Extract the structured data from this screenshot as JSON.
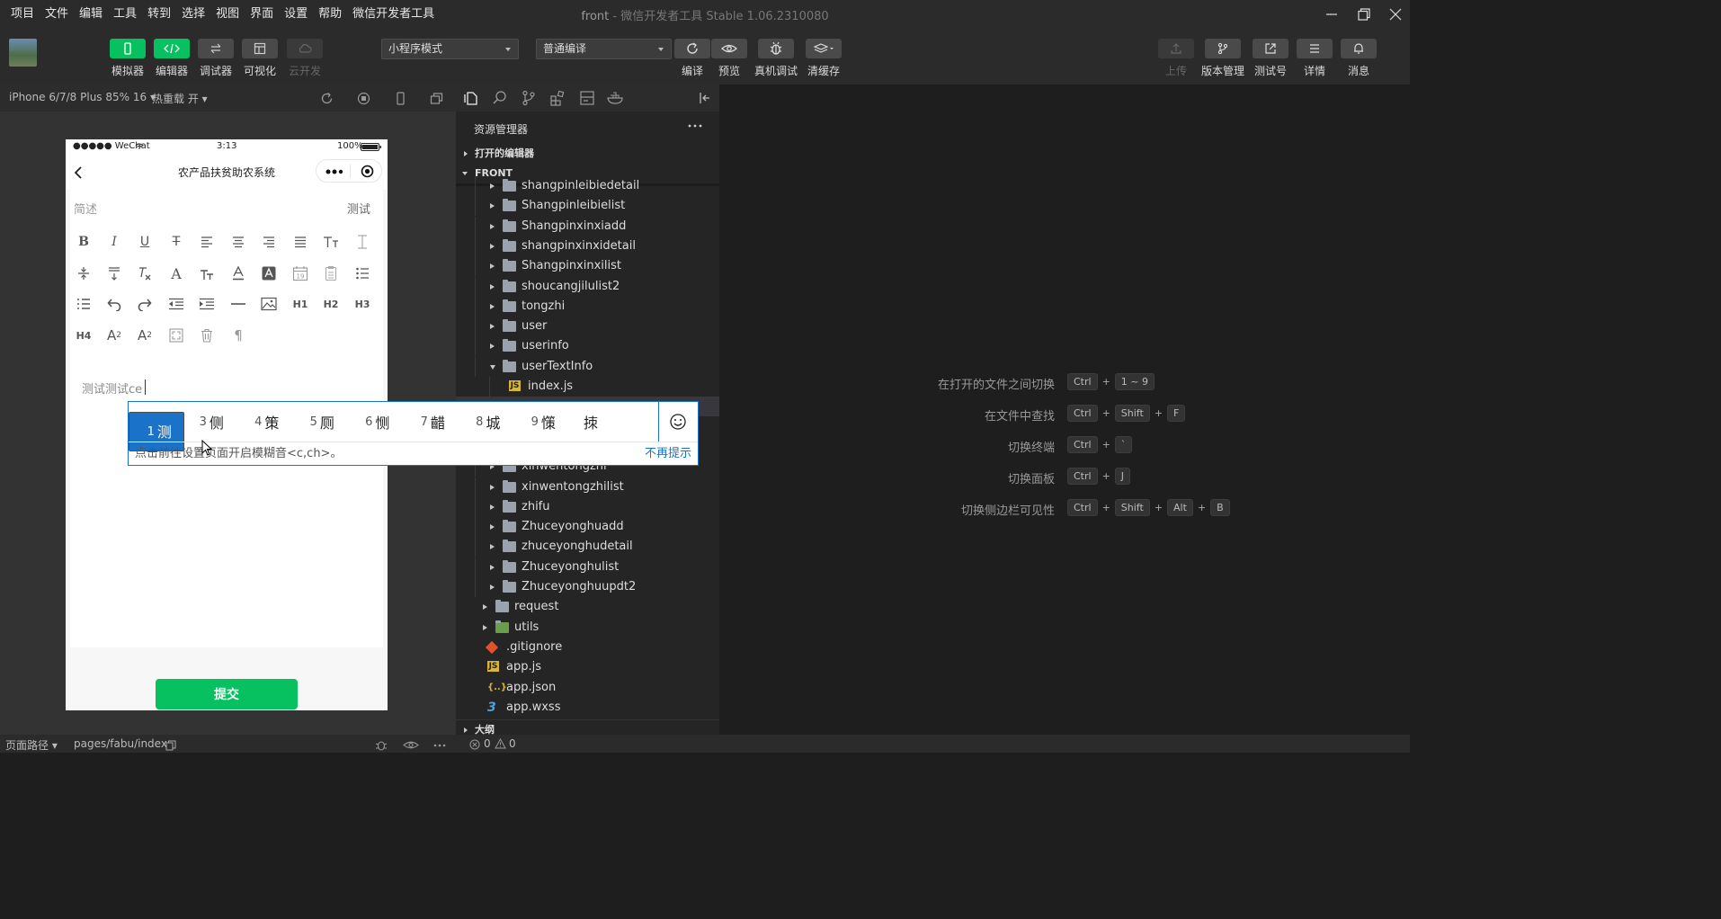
{
  "menubar": {
    "menus": [
      "项目",
      "文件",
      "编辑",
      "工具",
      "转到",
      "选择",
      "视图",
      "界面",
      "设置",
      "帮助",
      "微信开发者工具"
    ],
    "title_project": "front",
    "title_rest": " - 微信开发者工具 Stable 1.06.2310080"
  },
  "toolbar": {
    "left_buttons": [
      {
        "label": "模拟器",
        "icon": "phone-icon",
        "active": true
      },
      {
        "label": "编辑器",
        "icon": "code-icon",
        "active": true
      },
      {
        "label": "调试器",
        "icon": "debug-icon",
        "active": false
      },
      {
        "label": "可视化",
        "icon": "layout-icon",
        "active": false
      },
      {
        "label": "云开发",
        "icon": "cloud-icon",
        "active": false,
        "disabled": true
      }
    ],
    "mode_select": "小程序模式",
    "compile_select": "普通编译",
    "mid_buttons": [
      {
        "label": "编译",
        "icon": "refresh-icon"
      },
      {
        "label": "预览",
        "icon": "eye-icon"
      },
      {
        "label": "真机调试",
        "icon": "bug-icon"
      },
      {
        "label": "清缓存",
        "icon": "layers-icon"
      }
    ],
    "right_buttons": [
      {
        "label": "上传",
        "icon": "upload-icon",
        "disabled": true
      },
      {
        "label": "版本管理",
        "icon": "branch-icon"
      },
      {
        "label": "测试号",
        "icon": "external-icon"
      },
      {
        "label": "详情",
        "icon": "menu-icon"
      },
      {
        "label": "消息",
        "icon": "bell-icon"
      }
    ]
  },
  "simulator": {
    "device": "iPhone 6/7/8 Plus 85% 16",
    "hot_reload": "热重载 开",
    "status_left": "●●●●● WeChat",
    "status_time": "3:13",
    "status_battery": "100%",
    "page_title": "农产品扶贫助农系统",
    "field_label": "简述",
    "field_value": "测试",
    "editor_text": "测试测试ce",
    "submit_label": "提交",
    "toolbar_glyphs": {
      "h1": "H1",
      "h2": "H2",
      "h3": "H3",
      "h4": "H4",
      "calendar_day": "19",
      "pilcrow": "¶",
      "sub_base": "A",
      "sub_mark": "2",
      "sup_base": "A",
      "sup_mark": "2"
    }
  },
  "ime": {
    "candidates": [
      {
        "n": "1",
        "c": "测"
      },
      {
        "n": "2",
        "c": "册"
      },
      {
        "n": "3",
        "c": "侧"
      },
      {
        "n": "4",
        "c": "策"
      },
      {
        "n": "5",
        "c": "厕"
      },
      {
        "n": "6",
        "c": "恻"
      },
      {
        "n": "7",
        "c": "齰"
      },
      {
        "n": "8",
        "c": "城"
      },
      {
        "n": "9",
        "c": "憡"
      },
      {
        "n": "",
        "c": "拺"
      }
    ],
    "hint": "点击前往设置页面开启模糊音<c,ch>。",
    "no_more": "不再提示"
  },
  "explorer": {
    "title": "资源管理器",
    "open_editors": "打开的编辑器",
    "root": "FRONT",
    "items": [
      {
        "name": "shangpinleibiedetail",
        "type": "folder",
        "depth": 1,
        "open": false
      },
      {
        "name": "Shangpinleibielist",
        "type": "folder",
        "depth": 1,
        "open": false
      },
      {
        "name": "Shangpinxinxiadd",
        "type": "folder",
        "depth": 1,
        "open": false
      },
      {
        "name": "shangpinxinxidetail",
        "type": "folder",
        "depth": 1,
        "open": false
      },
      {
        "name": "Shangpinxinxilist",
        "type": "folder",
        "depth": 1,
        "open": false
      },
      {
        "name": "shoucangjilulist2",
        "type": "folder",
        "depth": 1,
        "open": false
      },
      {
        "name": "tongzhi",
        "type": "folder",
        "depth": 1,
        "open": false
      },
      {
        "name": "user",
        "type": "folder",
        "depth": 1,
        "open": false
      },
      {
        "name": "userinfo",
        "type": "folder",
        "depth": 1,
        "open": false
      },
      {
        "name": "userTextInfo",
        "type": "folder",
        "depth": 1,
        "open": true
      },
      {
        "name": "index.js",
        "type": "js",
        "depth": 2
      },
      {
        "name": "",
        "type": "hidden",
        "depth": 2
      },
      {
        "name": "",
        "type": "hidden",
        "depth": 2
      },
      {
        "name": "",
        "type": "hidden",
        "depth": 2
      },
      {
        "name": "xinwentongzhi",
        "type": "folder",
        "depth": 1,
        "open": false
      },
      {
        "name": "xinwentongzhilist",
        "type": "folder",
        "depth": 1,
        "open": false
      },
      {
        "name": "zhifu",
        "type": "folder",
        "depth": 1,
        "open": false
      },
      {
        "name": "Zhuceyonghuadd",
        "type": "folder",
        "depth": 1,
        "open": false
      },
      {
        "name": "zhuceyonghudetail",
        "type": "folder",
        "depth": 1,
        "open": false
      },
      {
        "name": "Zhuceyonghulist",
        "type": "folder",
        "depth": 1,
        "open": false
      },
      {
        "name": "Zhuceyonghuupdt2",
        "type": "folder",
        "depth": 1,
        "open": false
      },
      {
        "name": "request",
        "type": "folder",
        "depth": 0,
        "open": false
      },
      {
        "name": "utils",
        "type": "folder-green",
        "depth": 0,
        "open": false
      },
      {
        "name": ".gitignore",
        "type": "git",
        "depth": 0
      },
      {
        "name": "app.js",
        "type": "js",
        "depth": 0
      },
      {
        "name": "app.json",
        "type": "json",
        "depth": 0
      },
      {
        "name": "app.wxss",
        "type": "wxss",
        "depth": 0
      }
    ],
    "outline": "大纲"
  },
  "shortcuts": [
    {
      "label": "在打开的文件之间切换",
      "keys": [
        "Ctrl",
        "1 ~ 9"
      ]
    },
    {
      "label": "在文件中查找",
      "keys": [
        "Ctrl",
        "Shift",
        "F"
      ]
    },
    {
      "label": "切换终端",
      "keys": [
        "Ctrl",
        "`"
      ]
    },
    {
      "label": "切换面板",
      "keys": [
        "Ctrl",
        "J"
      ]
    },
    {
      "label": "切换侧边栏可见性",
      "keys": [
        "Ctrl",
        "Shift",
        "Alt",
        "B"
      ]
    }
  ],
  "bottombar": {
    "page_path_label": "页面路径",
    "page_path": "pages/fabu/index",
    "errors": "0",
    "warnings": "0"
  },
  "colors": {
    "accent_green": "#07c160",
    "ime_blue": "#1a73c8"
  }
}
